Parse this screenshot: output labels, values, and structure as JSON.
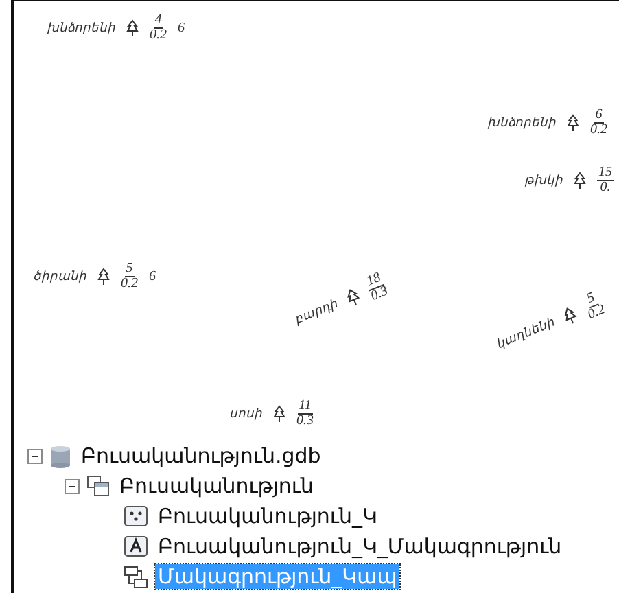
{
  "map_labels": [
    {
      "name": "խնձորենի",
      "numerator": "4",
      "denominator": "0.2",
      "suffix": "6"
    },
    {
      "name": "խնձորենի",
      "numerator": "6",
      "denominator": "0.2"
    },
    {
      "name": "թխկի",
      "numerator": "15",
      "denominator": "0."
    },
    {
      "name": "ծիրանի",
      "numerator": "5",
      "denominator": "0.2",
      "suffix": "6"
    },
    {
      "name": "բարդի",
      "numerator": "18",
      "denominator": "0.3"
    },
    {
      "name": "կաղնենի",
      "numerator": "5",
      "denominator": "0.2"
    },
    {
      "name": "սոսի",
      "numerator": "11",
      "denominator": "0.3"
    }
  ],
  "catalog_tree": [
    {
      "kind": "database",
      "label": "Բուսականություն.gdb",
      "expanded": true,
      "selected": false,
      "children": [
        {
          "kind": "dataset",
          "label": "Բուսականություն",
          "expanded": true,
          "selected": false,
          "children": [
            {
              "kind": "point_class",
              "label": "Բուսականություն_Կ",
              "selected": false
            },
            {
              "kind": "annotation_class",
              "label": "Բուսականություն_Կ_Մակագրություն",
              "selected": false
            },
            {
              "kind": "relationship",
              "label": "Մակագրություն_Կապ",
              "selected": true
            }
          ]
        }
      ]
    }
  ]
}
